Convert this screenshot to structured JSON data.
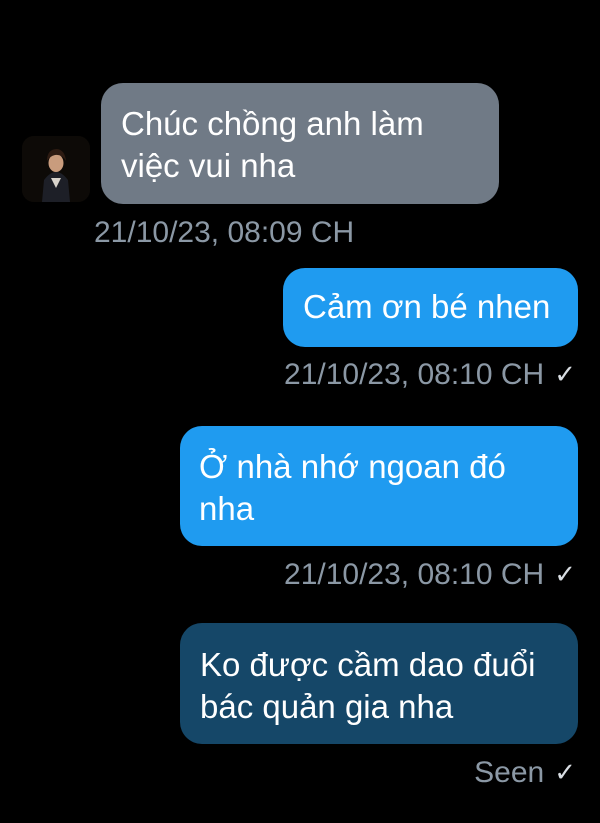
{
  "conversation": {
    "messages": [
      {
        "direction": "incoming",
        "text_lines": [
          "Chúc chồng anh làm",
          "việc vui nha"
        ],
        "timestamp": "21/10/23, 08:09 CH",
        "has_avatar": true
      },
      {
        "direction": "outgoing",
        "text_lines": [
          "Cảm ơn bé nhen"
        ],
        "timestamp": "21/10/23, 08:10 CH",
        "status_icon": "check-icon"
      },
      {
        "direction": "outgoing",
        "text_lines": [
          "Ở nhà nhớ ngoan đó",
          "nha"
        ],
        "timestamp": "21/10/23, 08:10 CH",
        "status_icon": "check-icon"
      },
      {
        "direction": "outgoing",
        "text_lines": [
          "Ko được cầm dao đuổi",
          "bác quản gia nha"
        ],
        "status": "Seen",
        "status_icon": "check-icon"
      }
    ]
  },
  "colors": {
    "background": "#000000",
    "incoming_bubble": "#707a86",
    "outgoing_bubble": "#1f9bf0",
    "last_outgoing_bubble": "#154768",
    "meta_text": "#8b98a5"
  }
}
